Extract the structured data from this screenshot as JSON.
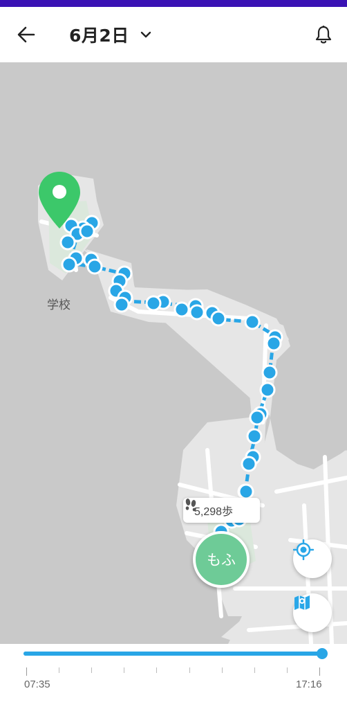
{
  "header": {
    "back_icon": "arrow-left-icon",
    "date_label": "6月2日",
    "dropdown_icon": "chevron-down-icon",
    "notification_icon": "bell-icon"
  },
  "map": {
    "place_label": "学校",
    "steps_label": "5,298歩",
    "steps_icon": "footprints-icon",
    "avatar_label": "もふ",
    "destination_icon": "map-pin-icon",
    "path_color": "#29a6e6",
    "pin_color": "#3cc86a"
  },
  "controls": {
    "locate_icon": "crosshair-locate-icon",
    "map_icon": "map-view-icon",
    "refresh_icon": "refresh-icon",
    "accent_color": "#2aa7e8"
  },
  "timeline": {
    "start_time": "07:35",
    "end_time": "17:16",
    "progress": 1.0
  }
}
